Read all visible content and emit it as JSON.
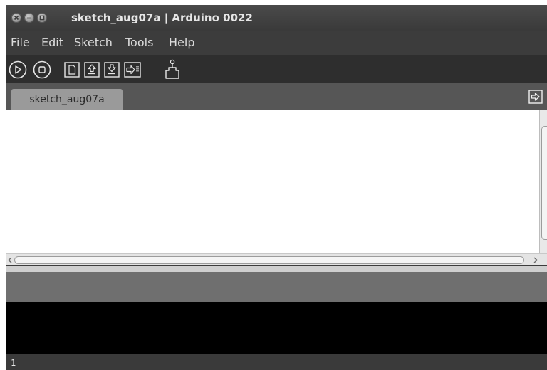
{
  "window": {
    "title": "sketch_aug07a | Arduino 0022"
  },
  "menu": {
    "items": [
      {
        "label": "File"
      },
      {
        "label": "Edit"
      },
      {
        "label": "Sketch"
      },
      {
        "label": "Tools"
      },
      {
        "label": "Help"
      }
    ]
  },
  "toolbar": {
    "buttons": [
      "verify-icon",
      "stop-icon",
      "new-icon",
      "open-icon",
      "save-icon",
      "upload-icon",
      "serial-monitor-icon"
    ]
  },
  "tabs": [
    {
      "label": "sketch_aug07a"
    }
  ],
  "status": {
    "line_number": "1"
  },
  "colors": {
    "chrome": "#3c3c3c",
    "toolbar": "#2e2e2e",
    "tab_active": "#9a9a9a",
    "console": "#000000",
    "status_area": "#6f6f6f"
  }
}
